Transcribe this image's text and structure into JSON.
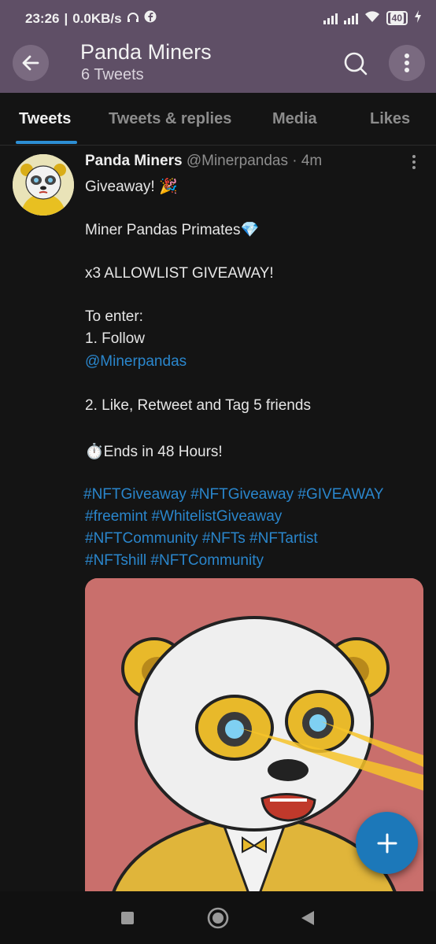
{
  "status_bar": {
    "time": "23:26",
    "speed": "0.0KB/s",
    "battery": "40"
  },
  "header": {
    "title": "Panda Miners",
    "subtitle": "6 Tweets"
  },
  "tabs": [
    {
      "label": "Tweets",
      "active": true
    },
    {
      "label": "Tweets & replies",
      "active": false
    },
    {
      "label": "Media",
      "active": false
    },
    {
      "label": "Likes",
      "active": false
    }
  ],
  "tweet": {
    "author_name": "Panda Miners",
    "meta": "@Minerpandas · 4m",
    "lines": [
      "Giveaway! 🎉",
      "Miner Pandas Primates💎",
      "x3 ALLOWLIST GIVEAWAY!",
      "To enter:",
      "1. Follow",
      "@Minerpandas",
      "2. Like, Retweet and Tag 5 friends",
      "⏱️Ends in 48 Hours!",
      " #NFTGiveaway  #NFTGiveaway #GIVEAWAY",
      "#freemint #WhitelistGiveaway",
      "#NFTCommunity #NFTs  #NFTartist",
      "#NFTshill #NFTCommunity"
    ]
  },
  "colors": {
    "accent": "#2d8fd5",
    "app_bar": "#5f4f66",
    "background": "#141414",
    "fab": "#1c78b9"
  }
}
